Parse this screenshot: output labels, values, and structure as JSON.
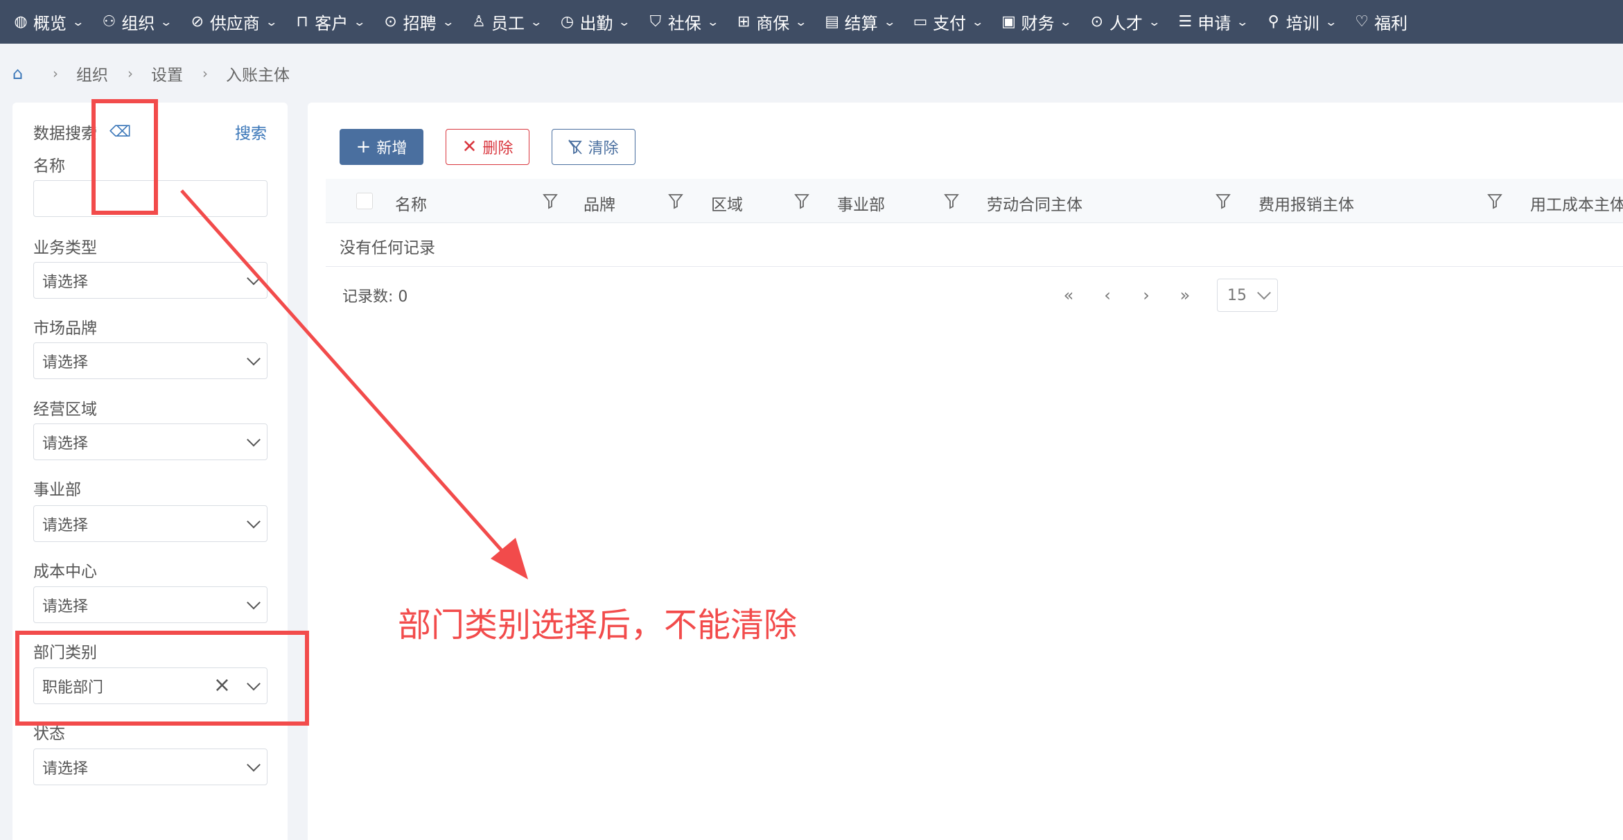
{
  "topnav": {
    "items": [
      {
        "label": "概览",
        "icon": "globe-icon"
      },
      {
        "label": "组织",
        "icon": "sitemap-icon"
      },
      {
        "label": "供应商",
        "icon": "link-icon"
      },
      {
        "label": "客户",
        "icon": "bag-icon"
      },
      {
        "label": "招聘",
        "icon": "check-circle-icon"
      },
      {
        "label": "员工",
        "icon": "user-icon"
      },
      {
        "label": "出勤",
        "icon": "clock-icon"
      },
      {
        "label": "社保",
        "icon": "shield-icon"
      },
      {
        "label": "商保",
        "icon": "gift-icon"
      },
      {
        "label": "结算",
        "icon": "calculator-icon"
      },
      {
        "label": "支付",
        "icon": "wallet-icon"
      },
      {
        "label": "财务",
        "icon": "money-icon"
      },
      {
        "label": "人才",
        "icon": "check-circle-icon"
      },
      {
        "label": "申请",
        "icon": "list-icon"
      },
      {
        "label": "培训",
        "icon": "key-icon"
      },
      {
        "label": "福利",
        "icon": "heart-icon"
      }
    ]
  },
  "breadcrumb": {
    "items": [
      "组织",
      "设置",
      "入账主体"
    ]
  },
  "search_panel": {
    "title": "数据搜索",
    "search_label": "搜索",
    "fields": [
      {
        "label": "名称",
        "value": "",
        "type": "text"
      },
      {
        "label": "业务类型",
        "value": "请选择",
        "type": "select"
      },
      {
        "label": "市场品牌",
        "value": "请选择",
        "type": "select"
      },
      {
        "label": "经营区域",
        "value": "请选择",
        "type": "select"
      },
      {
        "label": "事业部",
        "value": "请选择",
        "type": "select"
      },
      {
        "label": "成本中心",
        "value": "请选择",
        "type": "select"
      },
      {
        "label": "部门类别",
        "value": "职能部门",
        "type": "select"
      },
      {
        "label": "状态",
        "value": "请选择",
        "type": "select"
      }
    ]
  },
  "toolbar": {
    "add_label": "新增",
    "delete_label": "删除",
    "clear_label": "清除"
  },
  "table": {
    "columns": [
      "名称",
      "品牌",
      "区域",
      "事业部",
      "劳动合同主体",
      "费用报销主体",
      "用工成本主体"
    ],
    "empty_message": "没有任何记录"
  },
  "pagination": {
    "record_count_label": "记录数: 0",
    "page_size": "15"
  },
  "annotation": {
    "text": "部门类别选择后，不能清除",
    "color": "#f24b4b"
  },
  "colors": {
    "nav_bg": "#3f4d64",
    "primary": "#4a6f9f",
    "danger": "#d9363e",
    "link": "#3a76b8"
  }
}
